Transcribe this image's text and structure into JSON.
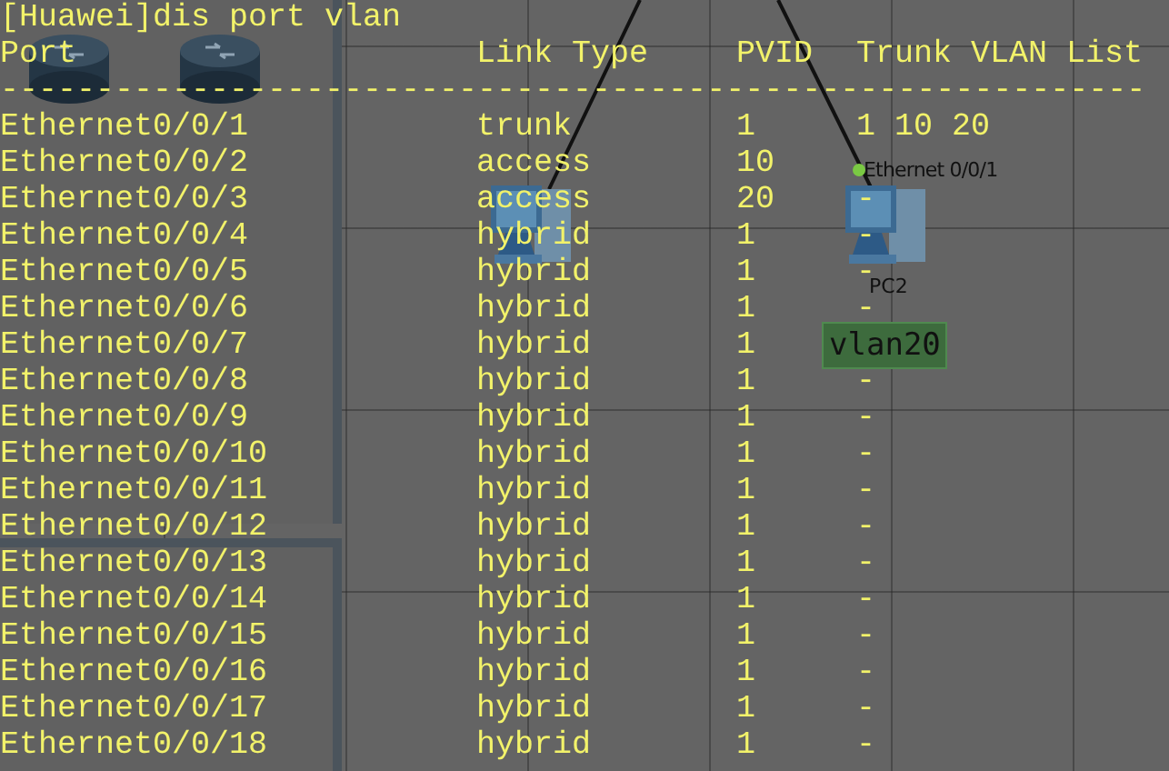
{
  "topology": {
    "devices": [
      {
        "kind": "router"
      },
      {
        "kind": "router"
      },
      {
        "kind": "pc"
      },
      {
        "kind": "pc",
        "label": "PC2"
      }
    ],
    "port_labels": [
      "Ethernet 0/0/1"
    ],
    "vlan_labels": [
      "vlan20"
    ]
  },
  "terminal": {
    "command": "[Huawei]dis port vlan",
    "columns": [
      "Port",
      "Link Type",
      "PVID",
      "Trunk VLAN List"
    ],
    "separator": "------------------------------------------------------------",
    "rows": [
      {
        "port": "Ethernet0/0/1",
        "link_type": "trunk",
        "pvid": "1",
        "trunk_vlan_list": "1 10 20"
      },
      {
        "port": "Ethernet0/0/2",
        "link_type": "access",
        "pvid": "10"
      },
      {
        "port": "Ethernet0/0/3",
        "link_type": "access",
        "pvid": "20",
        "trunk_vlan_list": "-"
      },
      {
        "port": "Ethernet0/0/4",
        "link_type": "hybrid",
        "pvid": "1",
        "trunk_vlan_list": "-"
      },
      {
        "port": "Ethernet0/0/5",
        "link_type": "hybrid",
        "pvid": "1",
        "trunk_vlan_list": "-"
      },
      {
        "port": "Ethernet0/0/6",
        "link_type": "hybrid",
        "pvid": "1",
        "trunk_vlan_list": "-"
      },
      {
        "port": "Ethernet0/0/7",
        "link_type": "hybrid",
        "pvid": "1"
      },
      {
        "port": "Ethernet0/0/8",
        "link_type": "hybrid",
        "pvid": "1",
        "trunk_vlan_list": "-"
      },
      {
        "port": "Ethernet0/0/9",
        "link_type": "hybrid",
        "pvid": "1",
        "trunk_vlan_list": "-"
      },
      {
        "port": "Ethernet0/0/10",
        "link_type": "hybrid",
        "pvid": "1",
        "trunk_vlan_list": "-"
      },
      {
        "port": "Ethernet0/0/11",
        "link_type": "hybrid",
        "pvid": "1",
        "trunk_vlan_list": "-"
      },
      {
        "port": "Ethernet0/0/12",
        "link_type": "hybrid",
        "pvid": "1",
        "trunk_vlan_list": "-"
      },
      {
        "port": "Ethernet0/0/13",
        "link_type": "hybrid",
        "pvid": "1",
        "trunk_vlan_list": "-"
      },
      {
        "port": "Ethernet0/0/14",
        "link_type": "hybrid",
        "pvid": "1",
        "trunk_vlan_list": "-"
      },
      {
        "port": "Ethernet0/0/15",
        "link_type": "hybrid",
        "pvid": "1",
        "trunk_vlan_list": "-"
      },
      {
        "port": "Ethernet0/0/16",
        "link_type": "hybrid",
        "pvid": "1",
        "trunk_vlan_list": "-"
      },
      {
        "port": "Ethernet0/0/17",
        "link_type": "hybrid",
        "pvid": "1",
        "trunk_vlan_list": "-"
      },
      {
        "port": "Ethernet0/0/18",
        "link_type": "hybrid",
        "pvid": "1",
        "trunk_vlan_list": "-"
      }
    ]
  }
}
